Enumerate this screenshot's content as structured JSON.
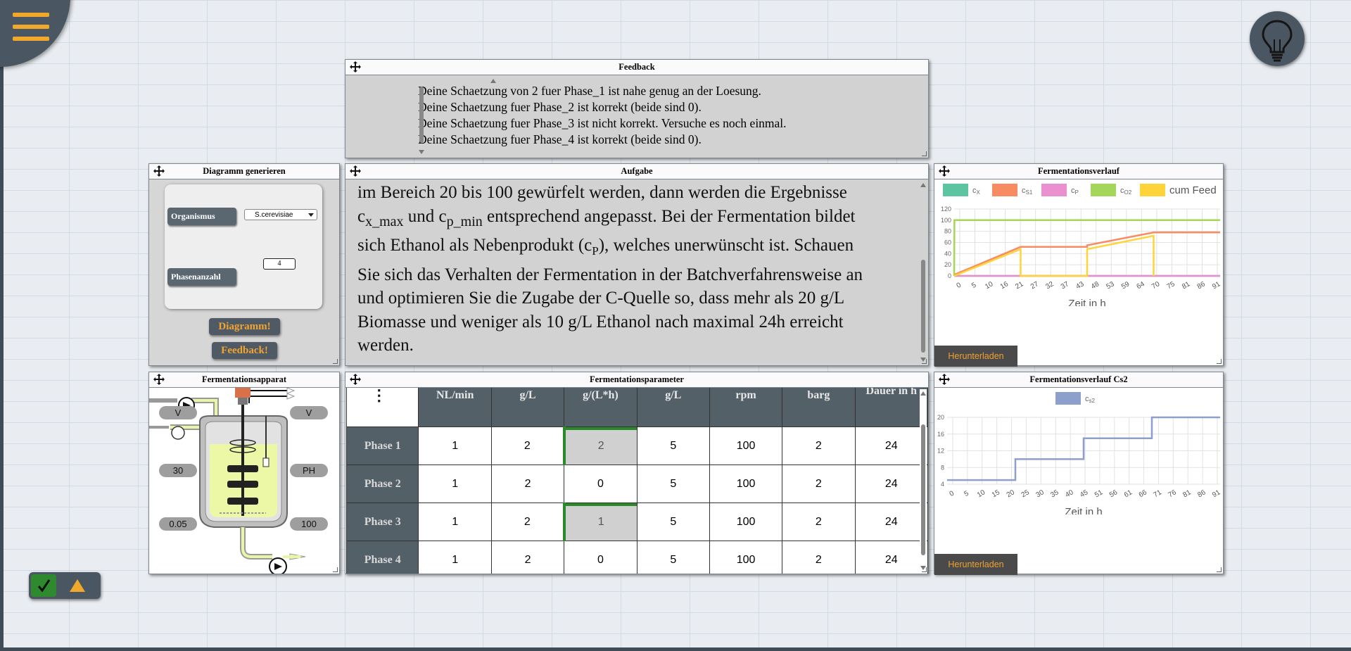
{
  "menu": {
    "icon": "hamburger-menu-icon"
  },
  "hint": {
    "icon": "lightbulb-icon"
  },
  "colors": {
    "accent": "#f0a92a",
    "panel_dark": "#4a5763",
    "ok_green": "#2f8a2f"
  },
  "windows": {
    "feedback": {
      "title": "Feedback",
      "lines": [
        "Deine Schaetzung von 2 fuer Phase_1 ist nahe genug an der Loesung.",
        "Deine Schaetzung fuer Phase_2 ist korrekt (beide sind 0).",
        "Deine Schaetzung fuer Phase_3 ist nicht korrekt. Versuche es noch einmal.",
        "Deine Schaetzung fuer Phase_4 ist korrekt (beide sind 0)."
      ]
    },
    "aufgabe": {
      "title": "Aufgabe",
      "l1": "im Bereich 20 bis 100 gewürfelt werden, dann werden die Ergebnisse",
      "l2a": "c",
      "l2b": "x_max",
      "l2c": " und c",
      "l2d": "p_min",
      "l2e": " entsprechend angepasst. Bei der Fermentation bildet",
      "l3a": "sich Ethanol als Nebenprodukt (c",
      "l3b": "P",
      "l3c": "), welches unerwünscht ist. Schauen",
      "l4": "Sie sich das Verhalten der Fermentation in der Batchverfahrensweise an",
      "l5": "und optimieren Sie die Zugabe der C-Quelle so, dass mehr als 20 g/L",
      "l6": "Biomasse und weniger als 10 g/L Ethanol nach maximal 24h erreicht",
      "l7": "werden."
    },
    "diagramm": {
      "title": "Diagramm generieren",
      "organismus_label": "Organismus",
      "organismus_value": "S.cerevisiae",
      "phasen_label": "Phasenanzahl",
      "phasen_value": "4",
      "diagramm_button": "Diagramm!",
      "feedback_button": "Feedback!"
    },
    "verlauf": {
      "title": "Fermentationsverlauf",
      "download": "Herunterladen"
    },
    "apparat": {
      "title": "Fermentationsapparat",
      "pills": [
        "V",
        "V",
        "30",
        "PH",
        "0.05",
        "100"
      ]
    },
    "parameter": {
      "title": "Fermentationsparameter",
      "menu_icon": "vertical-dots-icon",
      "headers": [
        "NL/min",
        "g/L",
        "g/(L*h)",
        "g/L",
        "rpm",
        "barg",
        "Dauer in h"
      ],
      "rows": [
        {
          "label": "Phase 1",
          "cells": [
            "1",
            "2",
            "2",
            "5",
            "100",
            "2",
            "24"
          ]
        },
        {
          "label": "Phase 2",
          "cells": [
            "1",
            "2",
            "0",
            "5",
            "100",
            "2",
            "24"
          ]
        },
        {
          "label": "Phase 3",
          "cells": [
            "1",
            "2",
            "1",
            "5",
            "100",
            "2",
            "24"
          ]
        },
        {
          "label": "Phase 4",
          "cells": [
            "1",
            "2",
            "0",
            "5",
            "100",
            "2",
            "24"
          ]
        }
      ]
    },
    "verlauf_cs2": {
      "title": "Fermentationsverlauf Cs2",
      "download": "Herunterladen"
    }
  },
  "chart_data": [
    {
      "type": "line",
      "xlabel": "Zeit in h",
      "ylabel": "",
      "ylim": [
        0,
        120
      ],
      "yticks": [
        0,
        20,
        40,
        60,
        80,
        100,
        120
      ],
      "xticks": [
        "0",
        "5",
        "10",
        "16",
        "21",
        "27",
        "32",
        "37",
        "43",
        "48",
        "53",
        "59",
        "64",
        "70",
        "75",
        "81",
        "86",
        "91"
      ],
      "grid": true,
      "legend_position": "top",
      "legend_entries": [
        {
          "name": "cX",
          "color": "#5cc4a0"
        },
        {
          "name": "cS1",
          "color": "#f78b62"
        },
        {
          "name": "cP",
          "color": "#ea8fcf"
        },
        {
          "name": "cO2",
          "color": "#a4d65a"
        },
        {
          "name": "cum Feed",
          "color": "#ffd43b"
        }
      ],
      "series": [
        {
          "name": "cX",
          "color": "#5cc4a0",
          "x": [
            0,
            96
          ],
          "y": [
            0,
            0
          ]
        },
        {
          "name": "cS1",
          "color": "#f78b62",
          "x": [
            0,
            24,
            24,
            48,
            48,
            72,
            72,
            96
          ],
          "y": [
            2,
            52,
            52,
            52,
            55,
            78,
            78,
            78
          ]
        },
        {
          "name": "cP",
          "color": "#ea8fcf",
          "x": [
            0,
            96
          ],
          "y": [
            0,
            0
          ]
        },
        {
          "name": "cO2",
          "color": "#a4d65a",
          "x": [
            0,
            0.1,
            96
          ],
          "y": [
            0,
            100,
            100
          ]
        },
        {
          "name": "cum Feed",
          "color": "#ffd43b",
          "x": [
            0,
            24,
            24,
            48,
            48,
            72,
            72
          ],
          "y": [
            0,
            48,
            0,
            0,
            48,
            72,
            0
          ]
        }
      ]
    },
    {
      "type": "line",
      "xlabel": "Zeit in h",
      "ylabel": "",
      "ylim": [
        4,
        20
      ],
      "yticks": [
        4,
        8,
        12,
        16,
        20
      ],
      "xticks": [
        "0",
        "5",
        "10",
        "15",
        "20",
        "25",
        "30",
        "35",
        "40",
        "45",
        "51",
        "56",
        "61",
        "66",
        "71",
        "76",
        "81",
        "86",
        "91"
      ],
      "grid": true,
      "legend_position": "top",
      "legend_entries": [
        {
          "name": "cs2",
          "color": "#8da0cb"
        }
      ],
      "series": [
        {
          "name": "cs2",
          "color": "#8da0cb",
          "x": [
            0,
            24,
            24,
            48,
            48,
            72,
            72,
            96
          ],
          "y": [
            5,
            5,
            10,
            10,
            15,
            15,
            20,
            20
          ]
        }
      ]
    }
  ]
}
